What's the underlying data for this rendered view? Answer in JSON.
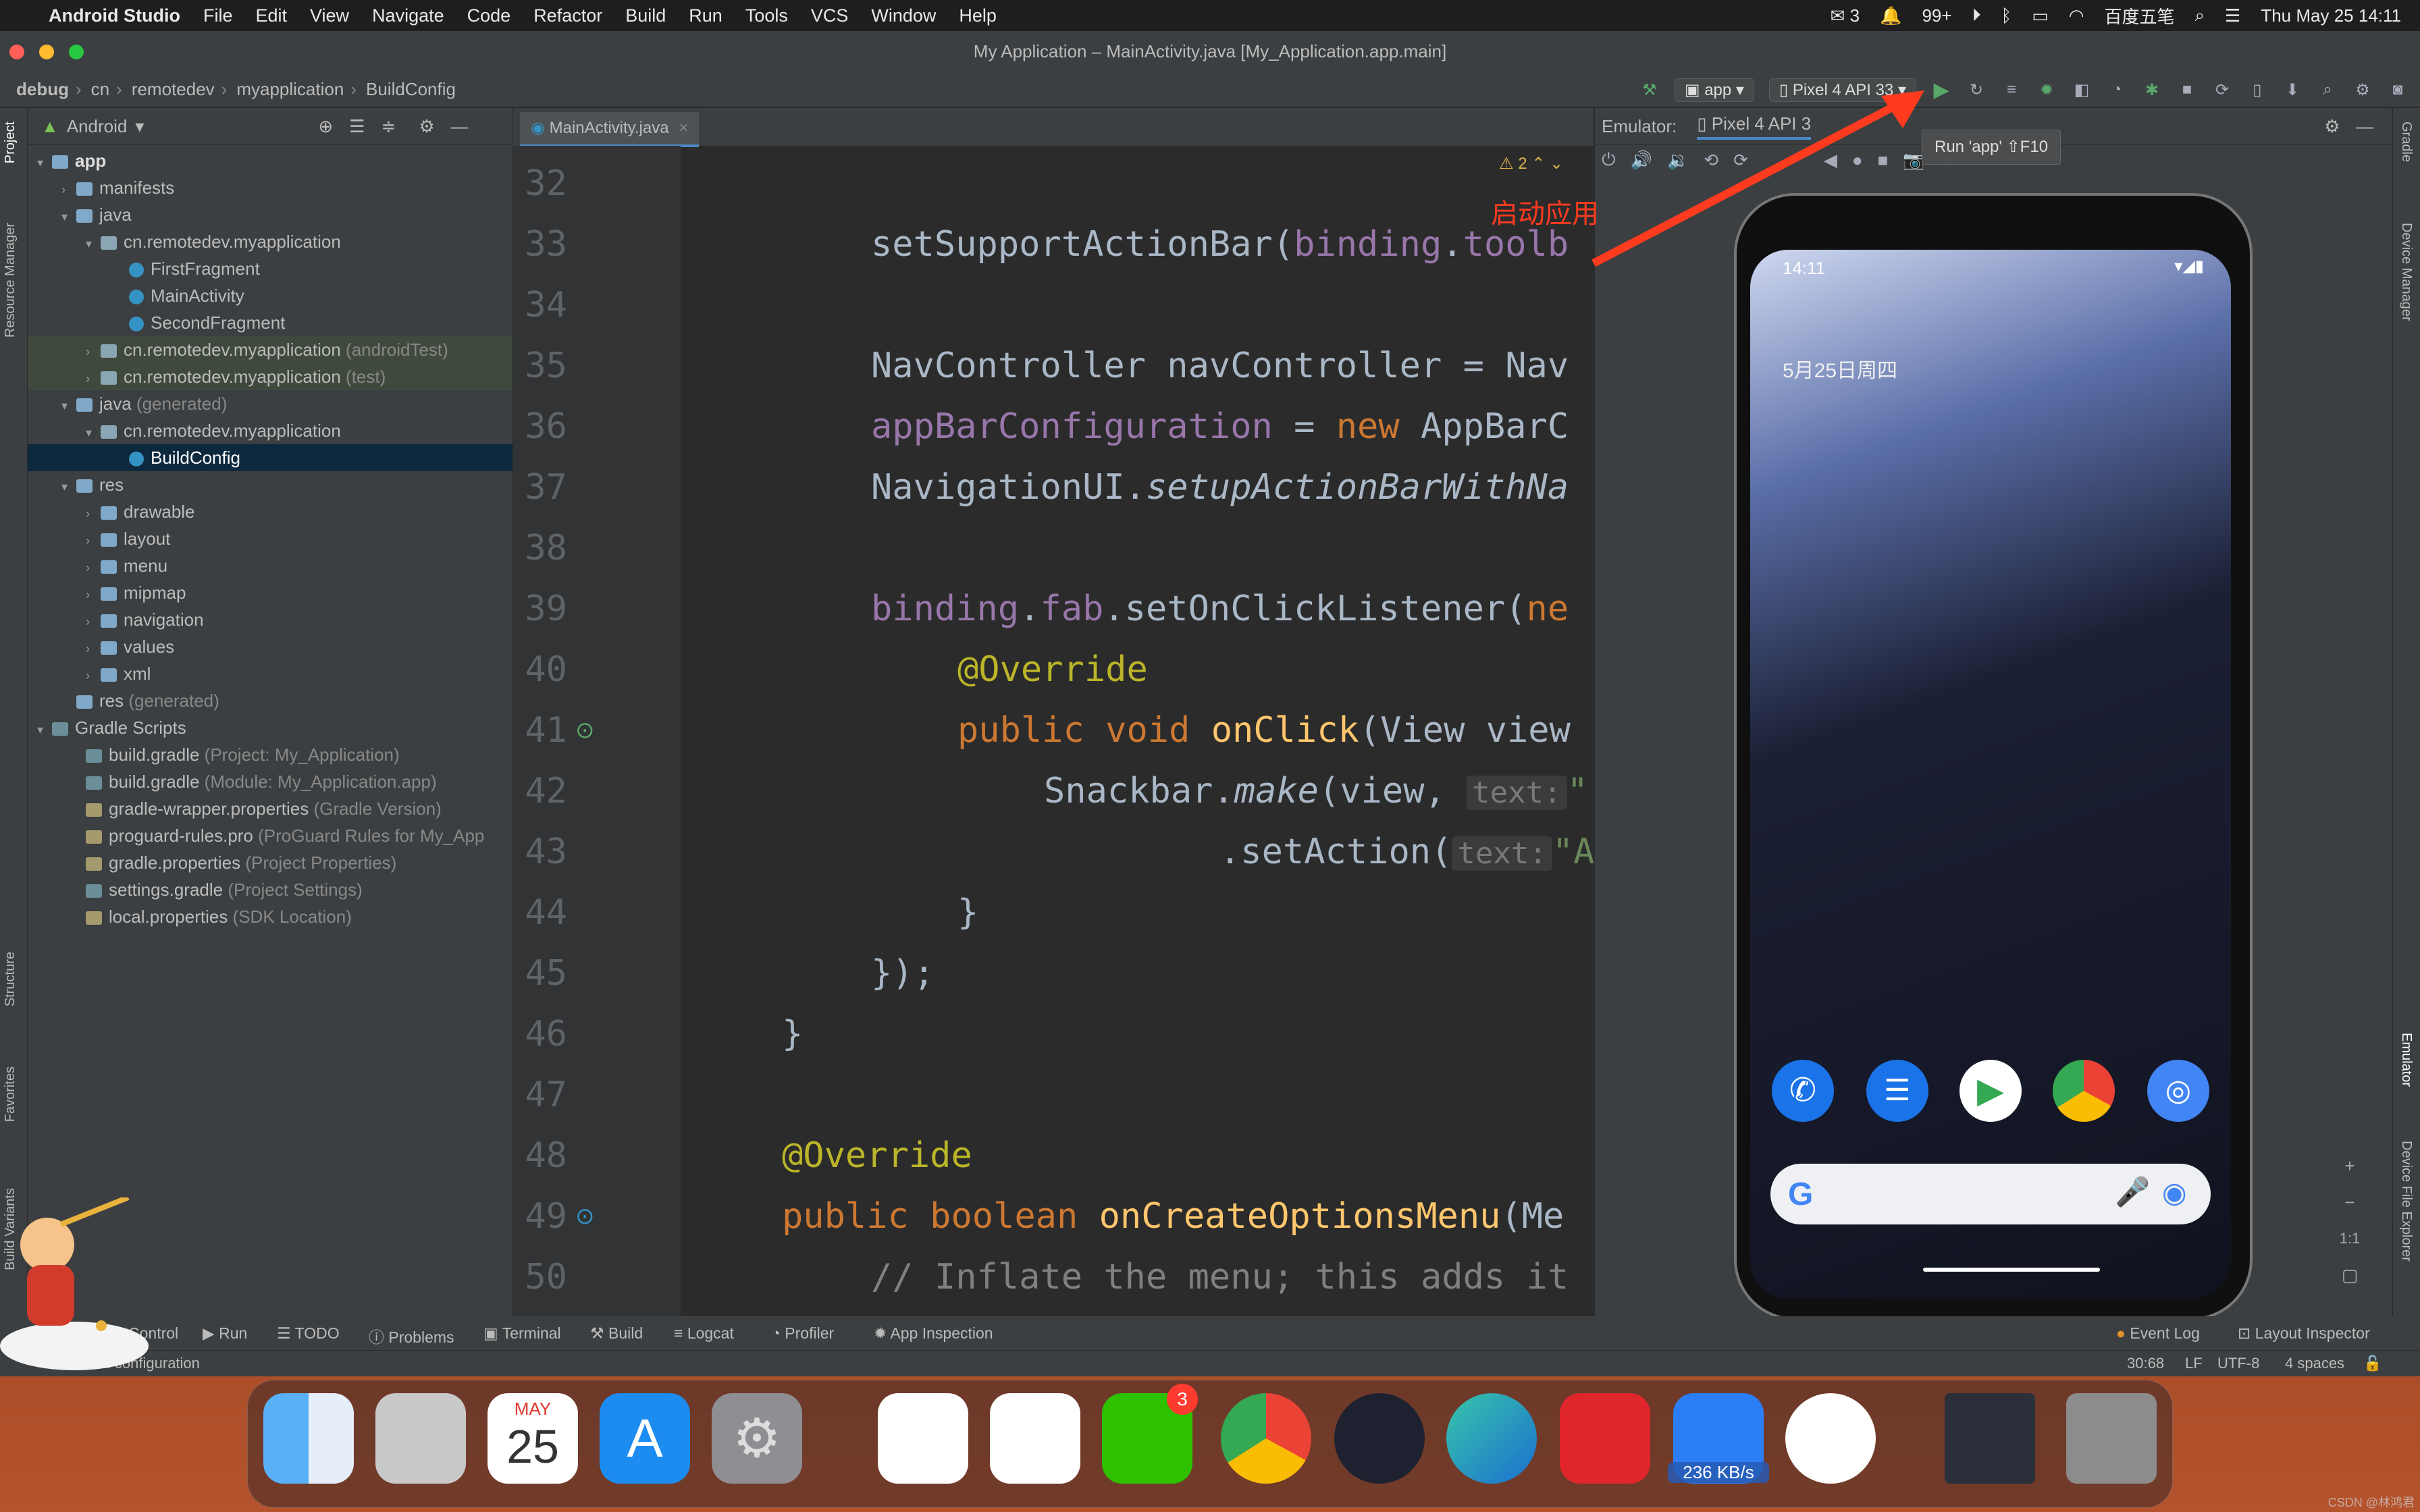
{
  "menubar": {
    "app_name": "Android Studio",
    "items": [
      "File",
      "Edit",
      "View",
      "Navigate",
      "Code",
      "Refactor",
      "Build",
      "Run",
      "Tools",
      "VCS",
      "Window",
      "Help"
    ],
    "status_right": {
      "wechat_count": "3",
      "notifications": "99+",
      "ime": "百度五笔",
      "datetime": "Thu May 25  14:11"
    }
  },
  "window": {
    "title": "My Application – MainActivity.java [My_Application.app.main]"
  },
  "navbar": {
    "breadcrumbs": [
      "debug",
      "cn",
      "remotedev",
      "myapplication",
      "BuildConfig"
    ],
    "run_config": "app",
    "device": "Pixel 4 API 33"
  },
  "project": {
    "view_mode": "Android",
    "tree": [
      {
        "label": "app",
        "level": 0,
        "icon": "folder",
        "expanded": true
      },
      {
        "label": "manifests",
        "level": 1,
        "icon": "folder"
      },
      {
        "label": "java",
        "level": 1,
        "icon": "folder",
        "expanded": true
      },
      {
        "label": "cn.remotedev.myapplication",
        "level": 2,
        "icon": "package",
        "expanded": true
      },
      {
        "label": "FirstFragment",
        "level": 3,
        "icon": "class"
      },
      {
        "label": "MainActivity",
        "level": 3,
        "icon": "class"
      },
      {
        "label": "SecondFragment",
        "level": 3,
        "icon": "class"
      },
      {
        "label": "cn.remotedev.myapplication",
        "suffix": "(androidTest)",
        "level": 2,
        "icon": "package",
        "highlight": true
      },
      {
        "label": "cn.remotedev.myapplication",
        "suffix": "(test)",
        "level": 2,
        "icon": "package",
        "highlight": true
      },
      {
        "label": "java",
        "suffix": "(generated)",
        "level": 1,
        "icon": "folder",
        "expanded": true
      },
      {
        "label": "cn.remotedev.myapplication",
        "level": 2,
        "icon": "package",
        "expanded": true
      },
      {
        "label": "BuildConfig",
        "level": 3,
        "icon": "class",
        "selected": true
      },
      {
        "label": "res",
        "level": 1,
        "icon": "folder",
        "expanded": true
      },
      {
        "label": "drawable",
        "level": 2,
        "icon": "folder"
      },
      {
        "label": "layout",
        "level": 2,
        "icon": "folder"
      },
      {
        "label": "menu",
        "level": 2,
        "icon": "folder"
      },
      {
        "label": "mipmap",
        "level": 2,
        "icon": "folder"
      },
      {
        "label": "navigation",
        "level": 2,
        "icon": "folder"
      },
      {
        "label": "values",
        "level": 2,
        "icon": "folder"
      },
      {
        "label": "xml",
        "level": 2,
        "icon": "folder"
      },
      {
        "label": "res",
        "suffix": "(generated)",
        "level": 1,
        "icon": "folder"
      },
      {
        "label": "Gradle Scripts",
        "level": 0,
        "icon": "gradle",
        "expanded": true
      },
      {
        "label": "build.gradle",
        "suffix": "(Project: My_Application)",
        "level": 1,
        "icon": "gradle"
      },
      {
        "label": "build.gradle",
        "suffix": "(Module: My_Application.app)",
        "level": 1,
        "icon": "gradle"
      },
      {
        "label": "gradle-wrapper.properties",
        "suffix": "(Gradle Version)",
        "level": 1,
        "icon": "props"
      },
      {
        "label": "proguard-rules.pro",
        "suffix": "(ProGuard Rules for My_App",
        "level": 1,
        "icon": "props"
      },
      {
        "label": "gradle.properties",
        "suffix": "(Project Properties)",
        "level": 1,
        "icon": "props"
      },
      {
        "label": "settings.gradle",
        "suffix": "(Project Settings)",
        "level": 1,
        "icon": "gradle"
      },
      {
        "label": "local.properties",
        "suffix": "(SDK Location)",
        "level": 1,
        "icon": "props"
      }
    ]
  },
  "left_strip": {
    "project": "Project",
    "resource_manager": "Resource Manager",
    "structure": "Structure",
    "favorites": "Favorites",
    "build_variants": "Build Variants"
  },
  "right_strip": {
    "gradle": "Gradle",
    "device_manager": "Device Manager",
    "emulator": "Emulator",
    "device_file_explorer": "Device File Explorer"
  },
  "editor": {
    "tab": "MainActivity.java",
    "warnings": "2",
    "line_numbers": [
      "32",
      "33",
      "34",
      "35",
      "36",
      "37",
      "38",
      "39",
      "40",
      "41",
      "42",
      "43",
      "44",
      "45",
      "46",
      "47",
      "48",
      "49",
      "50"
    ]
  },
  "emulator": {
    "label": "Emulator:",
    "device_tab": "Pixel 4 API 3",
    "phone_time": "14:11",
    "phone_date": "5月25日周四",
    "zoom_ratio": "1:1"
  },
  "tooltip": {
    "text": "Run 'app'  ⇧F10"
  },
  "annotation": {
    "text": "启动应用"
  },
  "bottom_tabs": [
    "Control",
    "Run",
    "TODO",
    "Problems",
    "Terminal",
    "Build",
    "Logcat",
    "Profiler",
    "App Inspection"
  ],
  "bottom_right": {
    "event_log": "Event Log",
    "layout_inspector": "Layout Inspector"
  },
  "status": {
    "message": "ected configuration",
    "position": "30:68",
    "line_sep": "LF",
    "encoding": "UTF-8",
    "indent": "4 spaces"
  },
  "dock": {
    "calendar_month": "MAY",
    "calendar_day": "25",
    "wechat_badge": "3",
    "network_speed": "236 KB/s"
  },
  "watermark": "CSDN @林鸿君"
}
